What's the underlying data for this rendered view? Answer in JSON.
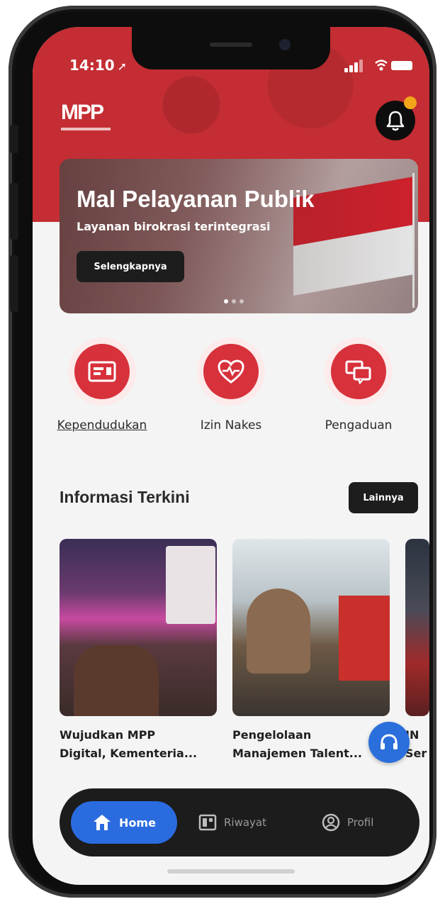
{
  "status_bar": {
    "time": "14:10"
  },
  "header": {
    "logo_text": "MPP"
  },
  "banner": {
    "title": "Mal Pelayanan Publik",
    "subtitle": "Layanan birokrasi terintegrasi",
    "button_label": "Selengkapnya"
  },
  "services": [
    {
      "label": "Kependudukan",
      "icon": "id-card-icon"
    },
    {
      "label": "Izin Nakes",
      "icon": "heart-pulse-icon"
    },
    {
      "label": "Pengaduan",
      "icon": "chat-bubbles-icon"
    }
  ],
  "news_section": {
    "title": "Informasi Terkini",
    "more_label": "Lainnya",
    "items": [
      {
        "title_line1": "Wujudkan MPP",
        "title_line2": "Digital, Kementeria..."
      },
      {
        "title_line1": "Pengelolaan",
        "title_line2": "Manajemen Talent..."
      },
      {
        "title_line1": "IN",
        "title_line2": "Ser"
      }
    ]
  },
  "bottom_nav": {
    "home": "Home",
    "history": "Riwayat",
    "profile": "Profil"
  },
  "colors": {
    "brand_red": "#c42d33",
    "accent_blue": "#2b6be0",
    "dark": "#1c1c1c"
  }
}
